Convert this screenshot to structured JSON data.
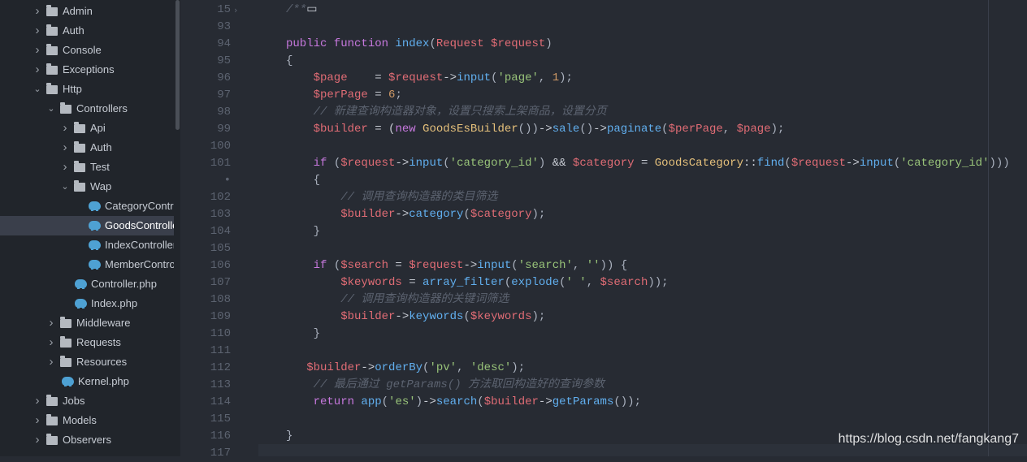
{
  "sidebar": {
    "items": [
      {
        "label": "Admin",
        "type": "folder",
        "expanded": false
      },
      {
        "label": "Auth",
        "type": "folder",
        "expanded": false
      },
      {
        "label": "Console",
        "type": "folder",
        "expanded": false
      },
      {
        "label": "Exceptions",
        "type": "folder",
        "expanded": false
      },
      {
        "label": "Http",
        "type": "folder",
        "expanded": true
      },
      {
        "label": "Controllers",
        "type": "folder",
        "expanded": true
      },
      {
        "label": "Api",
        "type": "folder",
        "expanded": false
      },
      {
        "label": "Auth",
        "type": "folder",
        "expanded": false
      },
      {
        "label": "Test",
        "type": "folder",
        "expanded": false
      },
      {
        "label": "Wap",
        "type": "folder",
        "expanded": true
      },
      {
        "label": "CategoryContro",
        "type": "php"
      },
      {
        "label": "GoodsControlle",
        "type": "php",
        "selected": true
      },
      {
        "label": "IndexController.",
        "type": "php"
      },
      {
        "label": "MemberControl",
        "type": "php"
      },
      {
        "label": "Controller.php",
        "type": "php"
      },
      {
        "label": "Index.php",
        "type": "php"
      },
      {
        "label": "Middleware",
        "type": "folder",
        "expanded": false
      },
      {
        "label": "Requests",
        "type": "folder",
        "expanded": false
      },
      {
        "label": "Resources",
        "type": "folder",
        "expanded": false
      },
      {
        "label": "Kernel.php",
        "type": "php"
      },
      {
        "label": "Jobs",
        "type": "folder",
        "expanded": false
      },
      {
        "label": "Models",
        "type": "folder",
        "expanded": false
      },
      {
        "label": "Observers",
        "type": "folder",
        "expanded": false
      }
    ]
  },
  "editor": {
    "line_numbers": [
      "15",
      "93",
      "94",
      "95",
      "96",
      "97",
      "98",
      "99",
      "100",
      "101",
      "•",
      "102",
      "103",
      "104",
      "105",
      "106",
      "107",
      "108",
      "109",
      "110",
      "111",
      "112",
      "113",
      "114",
      "115",
      "116",
      "117"
    ],
    "fold_marker": "›",
    "lines": [
      [
        [
          "cm",
          "/**"
        ],
        [
          "op",
          "▭"
        ]
      ],
      [],
      [
        [
          "kw",
          "public function "
        ],
        [
          "fn",
          "index"
        ],
        [
          "pun",
          "("
        ],
        [
          "var",
          "Request $request"
        ],
        [
          "pun",
          ")"
        ]
      ],
      [
        [
          "pun",
          "{"
        ]
      ],
      [
        [
          "var",
          "    $page"
        ],
        [
          "op",
          "    = "
        ],
        [
          "var",
          "$request"
        ],
        [
          "op",
          "->"
        ],
        [
          "fn",
          "input"
        ],
        [
          "pun",
          "("
        ],
        [
          "str",
          "'page'"
        ],
        [
          "pun",
          ", "
        ],
        [
          "num",
          "1"
        ],
        [
          "pun",
          ");"
        ]
      ],
      [
        [
          "var",
          "    $perPage"
        ],
        [
          "op",
          " = "
        ],
        [
          "num",
          "6"
        ],
        [
          "pun",
          ";"
        ]
      ],
      [
        [
          "cm",
          "    // 新建查询构造器对象，设置只搜索上架商品，设置分页"
        ]
      ],
      [
        [
          "var",
          "    $builder"
        ],
        [
          "op",
          " = ("
        ],
        [
          "kw",
          "new "
        ],
        [
          "cls",
          "GoodsEsBuilder"
        ],
        [
          "pun",
          "())"
        ],
        [
          "op",
          "->"
        ],
        [
          "fn",
          "sale"
        ],
        [
          "pun",
          "()"
        ],
        [
          "op",
          "->"
        ],
        [
          "fn",
          "paginate"
        ],
        [
          "pun",
          "("
        ],
        [
          "var",
          "$perPage"
        ],
        [
          "pun",
          ", "
        ],
        [
          "var",
          "$page"
        ],
        [
          "pun",
          ");"
        ]
      ],
      [],
      [
        [
          "kw",
          "    if "
        ],
        [
          "pun",
          "("
        ],
        [
          "var",
          "$request"
        ],
        [
          "op",
          "->"
        ],
        [
          "fn",
          "input"
        ],
        [
          "pun",
          "("
        ],
        [
          "str",
          "'category_id'"
        ],
        [
          "pun",
          ") "
        ],
        [
          "op",
          "&& "
        ],
        [
          "var",
          "$category"
        ],
        [
          "op",
          " = "
        ],
        [
          "cls",
          "GoodsCategory"
        ],
        [
          "op",
          "::"
        ],
        [
          "fn",
          "find"
        ],
        [
          "pun",
          "("
        ],
        [
          "var",
          "$request"
        ],
        [
          "op",
          "->"
        ],
        [
          "fn",
          "input"
        ],
        [
          "pun",
          "("
        ],
        [
          "str",
          "'category_id'"
        ],
        [
          "pun",
          ")))"
        ]
      ],
      [
        [
          "pun",
          "    {"
        ]
      ],
      [
        [
          "cm",
          "        // 调用查询构造器的类目筛选"
        ]
      ],
      [
        [
          "var",
          "        $builder"
        ],
        [
          "op",
          "->"
        ],
        [
          "fn",
          "category"
        ],
        [
          "pun",
          "("
        ],
        [
          "var",
          "$category"
        ],
        [
          "pun",
          ");"
        ]
      ],
      [
        [
          "pun",
          "    }"
        ]
      ],
      [],
      [
        [
          "kw",
          "    if "
        ],
        [
          "pun",
          "("
        ],
        [
          "var",
          "$search"
        ],
        [
          "op",
          " = "
        ],
        [
          "var",
          "$request"
        ],
        [
          "op",
          "->"
        ],
        [
          "fn",
          "input"
        ],
        [
          "pun",
          "("
        ],
        [
          "str",
          "'search'"
        ],
        [
          "pun",
          ", "
        ],
        [
          "str",
          "''"
        ],
        [
          "pun",
          ")) {"
        ]
      ],
      [
        [
          "var",
          "        $keywords"
        ],
        [
          "op",
          " = "
        ],
        [
          "fn",
          "array_filter"
        ],
        [
          "pun",
          "("
        ],
        [
          "fn",
          "explode"
        ],
        [
          "pun",
          "("
        ],
        [
          "str",
          "' '"
        ],
        [
          "pun",
          ", "
        ],
        [
          "var",
          "$search"
        ],
        [
          "pun",
          "));"
        ]
      ],
      [
        [
          "cm",
          "        // 调用查询构造器的关键词筛选"
        ]
      ],
      [
        [
          "var",
          "        $builder"
        ],
        [
          "op",
          "->"
        ],
        [
          "fn",
          "keywords"
        ],
        [
          "pun",
          "("
        ],
        [
          "var",
          "$keywords"
        ],
        [
          "pun",
          ");"
        ]
      ],
      [
        [
          "pun",
          "    }"
        ]
      ],
      [],
      [
        [
          "var",
          "   $builder"
        ],
        [
          "op",
          "->"
        ],
        [
          "fn",
          "orderBy"
        ],
        [
          "pun",
          "("
        ],
        [
          "str",
          "'pv'"
        ],
        [
          "pun",
          ", "
        ],
        [
          "str",
          "'desc'"
        ],
        [
          "pun",
          ");"
        ]
      ],
      [
        [
          "cm",
          "    // 最后通过 getParams() 方法取回构造好的查询参数"
        ]
      ],
      [
        [
          "kw",
          "    return "
        ],
        [
          "fn",
          "app"
        ],
        [
          "pun",
          "("
        ],
        [
          "str",
          "'es'"
        ],
        [
          "pun",
          ")"
        ],
        [
          "op",
          "->"
        ],
        [
          "fn",
          "search"
        ],
        [
          "pun",
          "("
        ],
        [
          "var",
          "$builder"
        ],
        [
          "op",
          "->"
        ],
        [
          "fn",
          "getParams"
        ],
        [
          "pun",
          "());"
        ]
      ],
      [],
      [
        [
          "pun",
          "}"
        ]
      ],
      []
    ]
  },
  "watermark": "https://blog.csdn.net/fangkang7",
  "colors": {
    "background": "#272b33",
    "sidebar": "#21252b",
    "keyword": "#c678dd",
    "function": "#61afef",
    "variable": "#e06c75",
    "string": "#98c379",
    "number": "#d19a66",
    "class": "#e5c07b",
    "comment": "#5c6370"
  }
}
